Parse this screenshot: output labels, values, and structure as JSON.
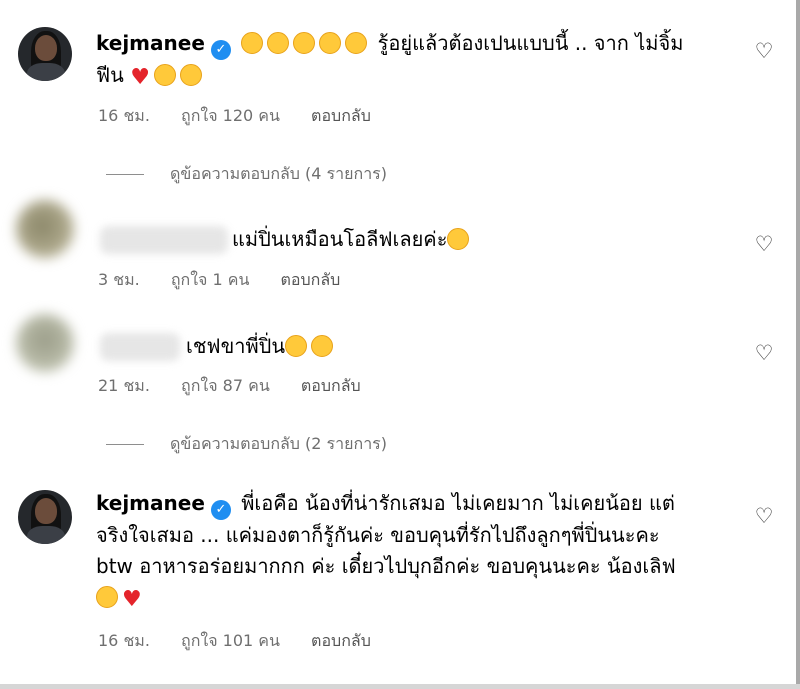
{
  "comments": [
    {
      "username": "kejmanee",
      "verified": true,
      "emojis_lead": [
        "rofl",
        "rofl",
        "rofl",
        "rofl",
        "rofl"
      ],
      "text_line1": "รู้อยู่แล้วต้องเปนแบบนี้ .. จาก ไม่จิ้ม",
      "text_line2": "ฟีน",
      "emojis_tail": [
        "red-heart",
        "raising-hands",
        "heart-eyes"
      ],
      "time": "16 ชม.",
      "likes": "ถูกใจ 120 คน",
      "reply_label": "ตอบกลับ",
      "view_replies": "ดูข้อความตอบกลับ (4 รายการ)"
    },
    {
      "username": "",
      "text": "แม่ปิ่นเหมือนโอลีฟเลยค่ะ",
      "emojis_tail": [
        "heart-eyes"
      ],
      "time": "3 ชม.",
      "likes": "ถูกใจ 1 คน",
      "reply_label": "ตอบกลับ"
    },
    {
      "username": "",
      "text": "เชฟขาพี่ปิ่น",
      "emojis_tail": [
        "grinning-sweat",
        "grinning-sweat"
      ],
      "time": "21 ชม.",
      "likes": "ถูกใจ 87 คน",
      "reply_label": "ตอบกลับ",
      "view_replies": "ดูข้อความตอบกลับ (2 รายการ)"
    },
    {
      "username": "kejmanee",
      "verified": true,
      "text_line1": "พี่เอคือ น้องที่น่ารักเสมอ ไม่เคยมาก ไม่เคยน้อย แต่",
      "text_line2": "จริงใจเสมอ ... แค่มองตาก็รู้กันค่ะ ขอบคุนที่รักไปถึงลูกๆพี่ปิ่นนะคะ",
      "text_line3": "btw อาหารอร่อยมากกก ค่ะ เดี๋ยวไปบุกอีกค่ะ ขอบคุนนะคะ น้องเลิฟ",
      "emojis_tail": [
        "heart-eyes",
        "red-heart"
      ],
      "time": "16 ชม.",
      "likes": "ถูกใจ 101 คน",
      "reply_label": "ตอบกลับ"
    }
  ],
  "icons": {
    "verified": "verified-badge-icon",
    "like": "heart-outline-icon"
  },
  "colors": {
    "verified": "#1f8ef1",
    "meta_text": "#6f6f6f",
    "heart": "#e4242b"
  }
}
